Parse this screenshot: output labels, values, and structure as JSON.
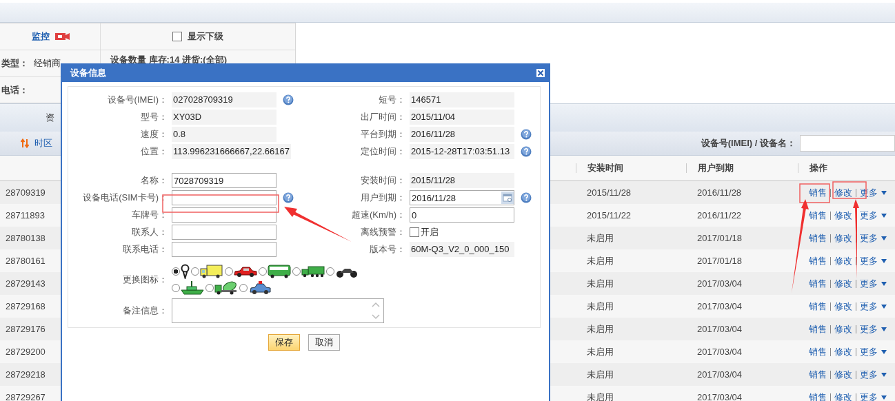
{
  "top_panel": {
    "monitor_link": "监控",
    "show_sub": {
      "label": "显示下级",
      "checked": false
    },
    "type_label": "类型：",
    "type_value": "经销商",
    "stock_text": "设备数量 库存:14 进货:(全部)",
    "phone_label": "电话："
  },
  "tab": {
    "label": "资"
  },
  "toolbar": {
    "timezone_button": "时区",
    "search_label": "设备号(IMEI) / 设备名："
  },
  "table": {
    "columns": [
      "安装时间",
      "用户到期",
      "操作"
    ],
    "rows": [
      {
        "imei": "28709319",
        "install": "2015/11/28",
        "expiry": "2016/11/28",
        "actions": [
          "销售",
          "修改",
          "更多"
        ]
      },
      {
        "imei": "28711893",
        "install": "2015/11/22",
        "expiry": "2016/11/22",
        "actions": [
          "销售",
          "修改",
          "更多"
        ]
      },
      {
        "imei": "28780138",
        "install": "未启用",
        "expiry": "2017/01/18",
        "actions": [
          "销售",
          "修改",
          "更多"
        ]
      },
      {
        "imei": "28780161",
        "install": "未启用",
        "expiry": "2017/01/18",
        "actions": [
          "销售",
          "修改",
          "更多"
        ]
      },
      {
        "imei": "28729143",
        "install": "未启用",
        "expiry": "2017/03/04",
        "actions": [
          "销售",
          "修改",
          "更多"
        ]
      },
      {
        "imei": "28729168",
        "install": "未启用",
        "expiry": "2017/03/04",
        "actions": [
          "销售",
          "修改",
          "更多"
        ]
      },
      {
        "imei": "28729176",
        "install": "未启用",
        "expiry": "2017/03/04",
        "actions": [
          "销售",
          "修改",
          "更多"
        ]
      },
      {
        "imei": "28729200",
        "install": "未启用",
        "expiry": "2017/03/04",
        "actions": [
          "销售",
          "修改",
          "更多"
        ]
      },
      {
        "imei": "28729218",
        "install": "未启用",
        "expiry": "2017/03/04",
        "actions": [
          "销售",
          "修改",
          "更多"
        ]
      },
      {
        "imei": "28729267",
        "install": "未启用",
        "expiry": "2017/03/04",
        "actions": [
          "销售",
          "修改",
          "更多"
        ]
      }
    ]
  },
  "dialog": {
    "title": "设备信息",
    "info_rows": [
      {
        "left": {
          "label": "设备号(IMEI)：",
          "kind": "readonly",
          "value": "027028709319",
          "help": true
        },
        "right": {
          "label": "短号：",
          "kind": "readonly",
          "value": "146571",
          "help": false
        }
      },
      {
        "left": {
          "label": "型号：",
          "kind": "readonly",
          "value": "XY03D",
          "help": false
        },
        "right": {
          "label": "出厂时间：",
          "kind": "readonly",
          "value": "2015/11/04",
          "help": false
        }
      },
      {
        "left": {
          "label": "速度：",
          "kind": "readonly",
          "value": "0.8",
          "help": false
        },
        "right": {
          "label": "平台到期：",
          "kind": "readonly",
          "value": "2016/11/28",
          "help": true
        }
      },
      {
        "left": {
          "label": "位置：",
          "kind": "readonly",
          "value": "113.996231666667,22.66167",
          "help": false
        },
        "right": {
          "label": "定位时间：",
          "kind": "readonly",
          "value": "2015-12-28T17:03:51.13",
          "help": true
        }
      }
    ],
    "edit_rows": [
      {
        "left": {
          "label": "名称：",
          "kind": "input",
          "value": "7028709319",
          "help": false
        },
        "right": {
          "label": "安装时间：",
          "kind": "readonly",
          "value": "2015/11/28",
          "help": false
        }
      },
      {
        "left": {
          "label": "设备电话(SIM卡号)：",
          "kind": "input",
          "help": true
        },
        "right": {
          "label": "用户到期：",
          "kind": "date",
          "value": "2016/11/28",
          "help": true
        }
      },
      {
        "left": {
          "label": "车牌号：",
          "kind": "input",
          "help": false
        },
        "right": {
          "label": "超速(Km/h)：",
          "kind": "input",
          "value": "0",
          "help": false
        }
      },
      {
        "left": {
          "label": "联系人：",
          "kind": "input",
          "help": false
        },
        "right": {
          "label": "离线预警：",
          "kind": "checkbox",
          "value": "开启",
          "checked": false,
          "help": false
        }
      },
      {
        "left": {
          "label": "联系电话：",
          "kind": "input",
          "help": false
        },
        "right": {
          "label": "版本号：",
          "kind": "readonly",
          "value": "60M-Q3_V2_0_000_150",
          "help": false
        }
      }
    ],
    "icon_chooser": {
      "label": "更换图标：",
      "options": [
        {
          "kind": "pin",
          "selected": true
        },
        {
          "kind": "truck",
          "selected": false
        },
        {
          "kind": "car",
          "selected": false
        },
        {
          "kind": "bus",
          "selected": false
        },
        {
          "kind": "lorry",
          "selected": false
        },
        {
          "kind": "motorcycle",
          "selected": false
        },
        {
          "kind": "boat",
          "selected": false
        },
        {
          "kind": "mixer",
          "selected": false
        },
        {
          "kind": "police",
          "selected": false
        }
      ]
    },
    "remark": {
      "label": "备注信息："
    },
    "buttons": [
      {
        "label": "保存",
        "kind": "primary"
      },
      {
        "label": "取消",
        "kind": "normal"
      }
    ]
  }
}
